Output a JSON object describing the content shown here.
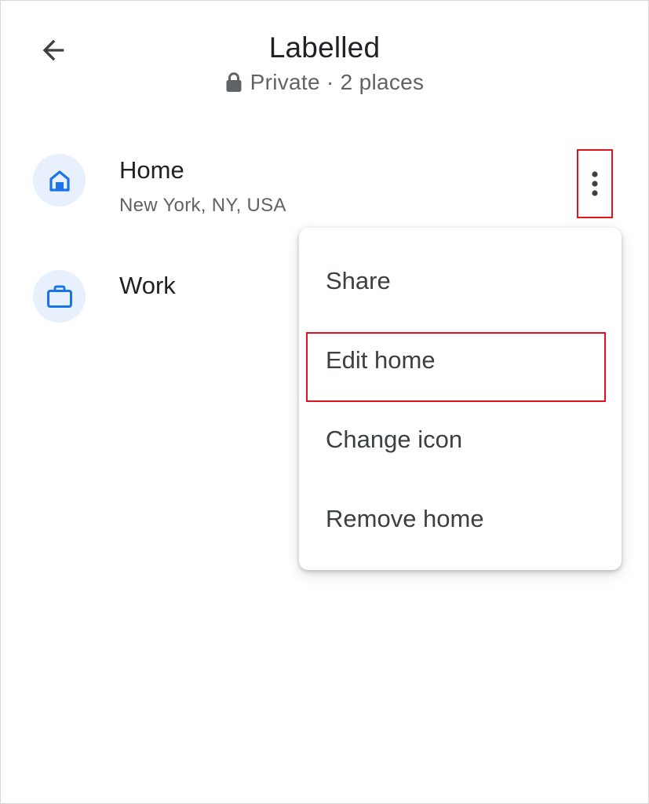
{
  "header": {
    "title": "Labelled",
    "subtitle": "Private · 2 places",
    "back_icon": "arrow-left-icon",
    "privacy_icon": "lock-icon"
  },
  "places": [
    {
      "name": "Home",
      "address": "New York, NY, USA",
      "icon": "home-icon"
    },
    {
      "name": "Work",
      "address": "",
      "icon": "briefcase-icon"
    }
  ],
  "more_button": {
    "icon": "more-vertical-icon"
  },
  "menu": {
    "items": [
      {
        "label": "Share"
      },
      {
        "label": "Edit home"
      },
      {
        "label": "Change icon"
      },
      {
        "label": "Remove home"
      }
    ]
  },
  "colors": {
    "accent_blue": "#1a73e8",
    "icon_bg": "#e8f0fe",
    "highlight_red": "#e0141e",
    "secondary_text": "#5f6368"
  }
}
